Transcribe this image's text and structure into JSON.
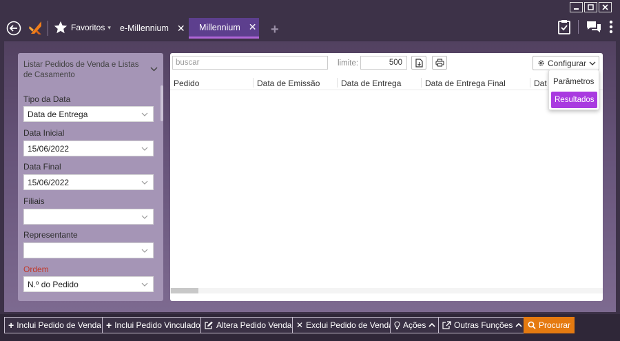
{
  "header": {
    "favorites_label": "Favoritos",
    "tabs": [
      {
        "label": "e-Millennium"
      },
      {
        "label": "Millennium"
      }
    ]
  },
  "left_panel": {
    "title": "Listar Pedidos de Venda e Listas de Casamento",
    "fields": [
      {
        "label": "Tipo da Data",
        "value": "Data de Entrega"
      },
      {
        "label": "Data Inicial",
        "value": "15/06/2022"
      },
      {
        "label": "Data Final",
        "value": "15/06/2022"
      },
      {
        "label": "Filiais",
        "value": ""
      },
      {
        "label": "Representante",
        "value": ""
      },
      {
        "label": "Ordem",
        "value": "N.º do Pedido"
      }
    ]
  },
  "main": {
    "search_placeholder": "buscar",
    "limit_label": "limite:",
    "limit_value": "500",
    "config_label": "Configurar",
    "columns": [
      "Pedido",
      "Data de Emissão",
      "Data de Entrega",
      "Data de Entrega Final",
      "Dat"
    ]
  },
  "config_menu": {
    "items": [
      "Parâmetros",
      "Resultados"
    ],
    "active": "Resultados"
  },
  "toolbar": {
    "buttons": [
      "Inclui Pedido de Venda",
      "Inclui Pedido Vinculado",
      "Altera Pedido Venda",
      "Exclui Pedido de Venda",
      "Ações",
      "Outras Funções",
      "Procurar"
    ]
  },
  "colors": {
    "accent": "#a93ae0",
    "tab_active": "#5d3f8e",
    "search_button": "#e57a10",
    "required_label": "#c0392b"
  }
}
